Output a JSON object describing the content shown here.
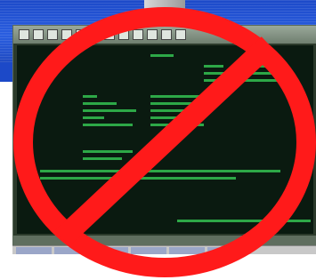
{
  "colors": {
    "banner": "#1c49c8",
    "terminal_bg": "#0a1a10",
    "terminal_text": "#39d85a",
    "prohibition_sign": "#ff1a1a"
  },
  "icons": {
    "prohibition": "no-symbol-icon"
  }
}
